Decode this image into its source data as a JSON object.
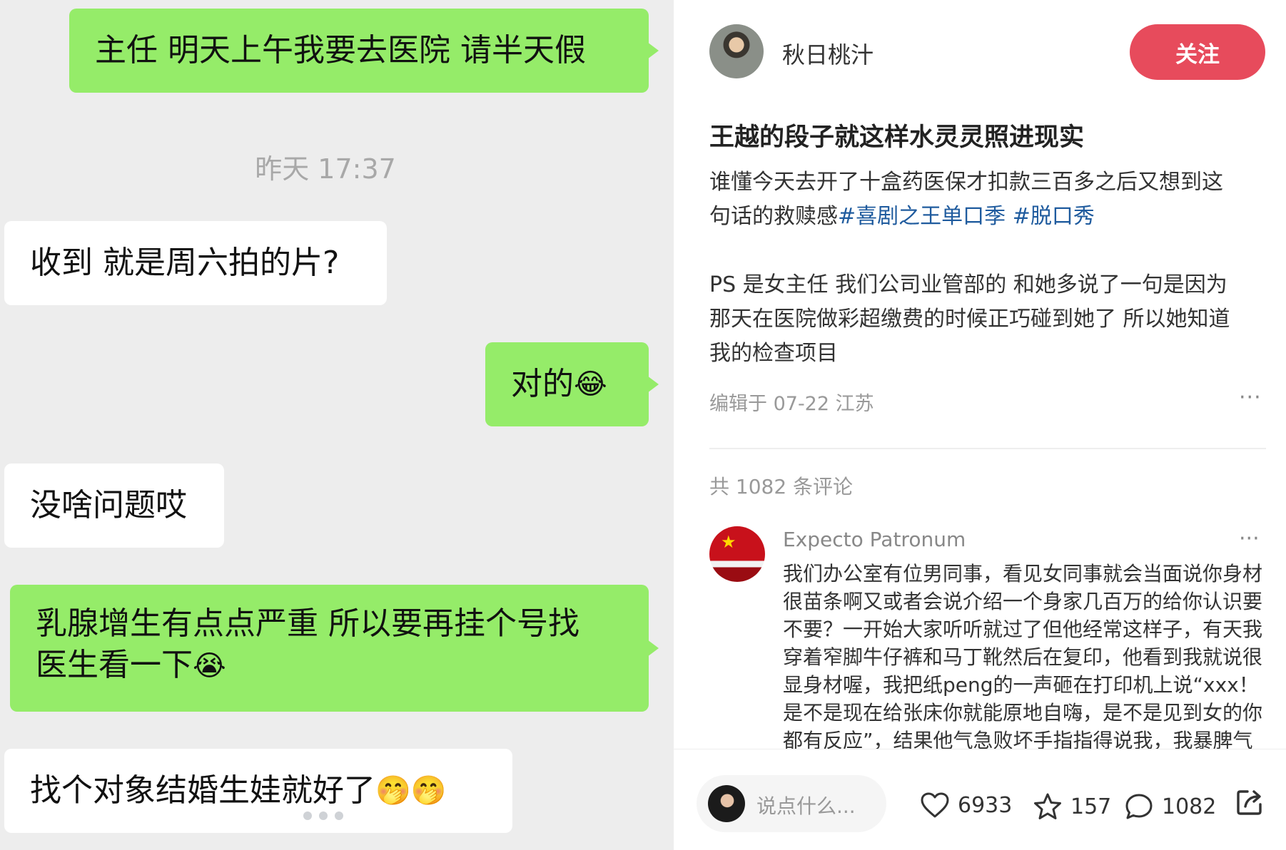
{
  "chat": {
    "messages": [
      {
        "side": "me",
        "text": "主任 明天上午我要去医院 请半天假"
      },
      {
        "side": "time",
        "text": "昨天 17:37"
      },
      {
        "side": "other",
        "text": "收到 就是周六拍的片?"
      },
      {
        "side": "me",
        "text": "对的",
        "emoji": "😂"
      },
      {
        "side": "other",
        "text": "没啥问题哎"
      },
      {
        "side": "me",
        "line1": "乳腺增生有点点严重 所以要再挂个号找",
        "line2": "医生看一下",
        "emoji": "😭"
      },
      {
        "side": "other",
        "text": "找个对象结婚生娃就好了",
        "emoji": "🤭🤭"
      }
    ]
  },
  "post": {
    "author": "秋日桃汁",
    "follow_label": "关注",
    "title": "王越的段子就这样水灵灵照进现实",
    "body_line1": "谁懂今天去开了十盒药医保才扣款三百多之后又想到这",
    "body_line2_text": "句话的救赎感",
    "tag1": "#喜剧之王单口季",
    "tag2": "#脱口秀",
    "ps_lines": [
      "PS 是女主任 我们公司业管部的 和她多说了一句是因为",
      "那天在医院做彩超缴费的时候正巧碰到她了 所以她知道",
      "我的检查项目"
    ],
    "meta": "编辑于 07-22 江苏",
    "more": "···",
    "comment_count": "共 1082 条评论"
  },
  "comment": {
    "name": "Expecto Patronum",
    "more": "···",
    "lines": [
      "我们办公室有位男同事，看见女同事就会当面说你身材",
      "很苗条啊又或者会说介绍一个身家几百万的给你认识要",
      "不要？一开始大家听听就过了但他经常这样子，有天我",
      "穿着窄脚牛仔裤和马丁靴然后在复印，他看到我就说很",
      "显身材喔，我把纸peng的一声砸在打印机上说“xxx！",
      "是不是现在给张床你就能原地自嗨，是不是见到女的你",
      "都有反应”，结果他气急败坏手指指得说我，我暴脾气"
    ]
  },
  "bottom": {
    "placeholder": "说点什么...",
    "likes": "6933",
    "stars": "157",
    "comments": "1082"
  },
  "colors": {
    "my_bubble": "#95ec69",
    "follow": "#e74b5c",
    "tag": "#1f5b9e"
  },
  "icons": [
    "heart-icon",
    "star-icon",
    "comment-icon",
    "share-icon"
  ]
}
